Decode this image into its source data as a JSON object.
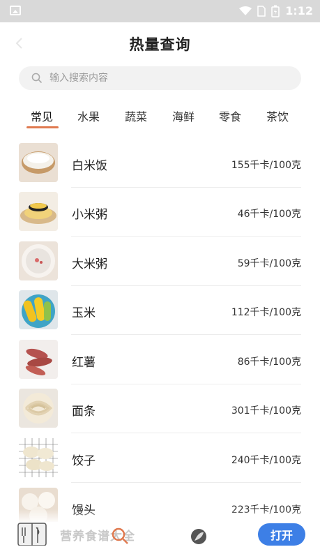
{
  "status_bar": {
    "time": "1:12"
  },
  "header": {
    "title": "热量查询"
  },
  "search": {
    "placeholder": "输入搜索内容"
  },
  "tabs": [
    {
      "label": "常见",
      "active": true
    },
    {
      "label": "水果",
      "active": false
    },
    {
      "label": "蔬菜",
      "active": false
    },
    {
      "label": "海鲜",
      "active": false
    },
    {
      "label": "零食",
      "active": false
    },
    {
      "label": "茶饮",
      "active": false
    }
  ],
  "foods": [
    {
      "name": "白米饭",
      "calories": "155千卡/100克",
      "image": "rice-bowl-image"
    },
    {
      "name": "小米粥",
      "calories": "46千卡/100克",
      "image": "millet-porridge-image"
    },
    {
      "name": "大米粥",
      "calories": "59千卡/100克",
      "image": "rice-porridge-image"
    },
    {
      "name": "玉米",
      "calories": "112千卡/100克",
      "image": "corn-image"
    },
    {
      "name": "红薯",
      "calories": "86千卡/100克",
      "image": "sweet-potato-image"
    },
    {
      "name": "面条",
      "calories": "301千卡/100克",
      "image": "noodles-image"
    },
    {
      "name": "饺子",
      "calories": "240千卡/100克",
      "image": "dumplings-image"
    },
    {
      "name": "馒头",
      "calories": "223千卡/100克",
      "image": "steamed-bun-image"
    }
  ],
  "bottom_bar": {
    "app_text": "营养食谱大全",
    "open_label": "打开"
  },
  "colors": {
    "accent": "#e07a50",
    "open_button": "#3d7fe6",
    "status_bar": "#d9d9d9"
  }
}
